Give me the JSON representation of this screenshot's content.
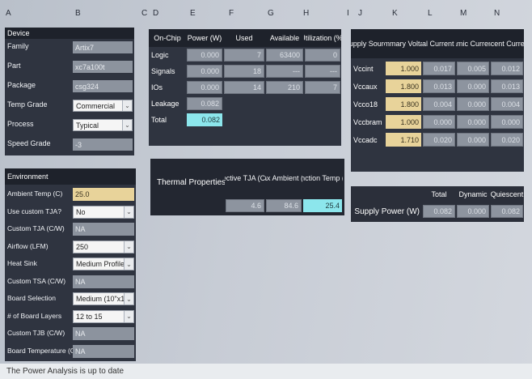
{
  "column_headers": [
    "A",
    "B",
    "C",
    "D",
    "E",
    "F",
    "G",
    "H",
    "I",
    "J",
    "K",
    "L",
    "M",
    "N"
  ],
  "device": {
    "title": "Device",
    "rows": [
      {
        "label": "Family",
        "value": "Artix7",
        "kind": "text"
      },
      {
        "label": "Part",
        "value": "xc7a100t",
        "kind": "text"
      },
      {
        "label": "Package",
        "value": "csg324",
        "kind": "text"
      },
      {
        "label": "Temp Grade",
        "value": "Commercial",
        "kind": "select"
      },
      {
        "label": "Process",
        "value": "Typical",
        "kind": "select"
      },
      {
        "label": "Speed Grade",
        "value": "-3",
        "kind": "text"
      }
    ]
  },
  "environment": {
    "title": "Environment",
    "rows": [
      {
        "label": "Ambient Temp (C)",
        "value": "25.0",
        "kind": "input"
      },
      {
        "label": "Use custom TJA?",
        "value": "No",
        "kind": "select"
      },
      {
        "label": "Custom TJA (C/W)",
        "value": "NA",
        "kind": "text"
      },
      {
        "label": "Airflow (LFM)",
        "value": "250",
        "kind": "select"
      },
      {
        "label": "Heat Sink",
        "value": "Medium Profile",
        "kind": "select"
      },
      {
        "label": "Custom TSA (C/W)",
        "value": "NA",
        "kind": "text"
      },
      {
        "label": "Board Selection",
        "value": "Medium (10\"x10\")",
        "kind": "select"
      },
      {
        "label": "# of Board Layers",
        "value": "12 to 15",
        "kind": "select"
      },
      {
        "label": "Custom TJB (C/W)",
        "value": "NA",
        "kind": "text"
      },
      {
        "label": "Board Temperature (C)",
        "value": "NA",
        "kind": "text"
      }
    ]
  },
  "onchip": {
    "headers": [
      "On-Chip",
      "Power (W)",
      "Used",
      "Available",
      "Utilization (%)"
    ],
    "rows": [
      {
        "name": "Logic",
        "power": "0.000",
        "used": "7",
        "available": "63400",
        "util": "0"
      },
      {
        "name": "Signals",
        "power": "0.000",
        "used": "18",
        "available": "---",
        "util": "---"
      },
      {
        "name": "IOs",
        "power": "0.000",
        "used": "14",
        "available": "210",
        "util": "7"
      },
      {
        "name": "Leakage",
        "power": "0.082",
        "used": "",
        "available": "",
        "util": ""
      },
      {
        "name": "Total",
        "power": "0.082",
        "used": "",
        "available": "",
        "util": ""
      }
    ]
  },
  "thermal": {
    "label": "Thermal  Properties",
    "headers": [
      "Effective TJA (C/W)",
      "Max Ambient (C)",
      "Junction Temp (C)"
    ],
    "values": [
      "4.6",
      "84.6",
      "25.4"
    ]
  },
  "supply": {
    "headers": [
      "Supply Source",
      "Summary Voltage",
      "Total Current (A)",
      "Dynamic Current (A)",
      "Quiescent Current (A)"
    ],
    "rows": [
      {
        "source": "Vccint",
        "voltage": "1.000",
        "total": "0.017",
        "dynamic": "0.005",
        "quiescent": "0.012"
      },
      {
        "source": "Vccaux",
        "voltage": "1.800",
        "total": "0.013",
        "dynamic": "0.000",
        "quiescent": "0.013"
      },
      {
        "source": "Vcco18",
        "voltage": "1.800",
        "total": "0.004",
        "dynamic": "0.000",
        "quiescent": "0.004"
      },
      {
        "source": "Vccbram",
        "voltage": "1.000",
        "total": "0.000",
        "dynamic": "0.000",
        "quiescent": "0.000"
      },
      {
        "source": "Vccadc",
        "voltage": "1.710",
        "total": "0.020",
        "dynamic": "0.000",
        "quiescent": "0.020"
      }
    ]
  },
  "supply_power": {
    "headers": [
      "Total",
      "Dynamic",
      "Quiescent"
    ],
    "label": "Supply  Power (W)",
    "values": [
      "0.082",
      "0.000",
      "0.082"
    ]
  },
  "status_bar": "The Power Analysis is up to date"
}
